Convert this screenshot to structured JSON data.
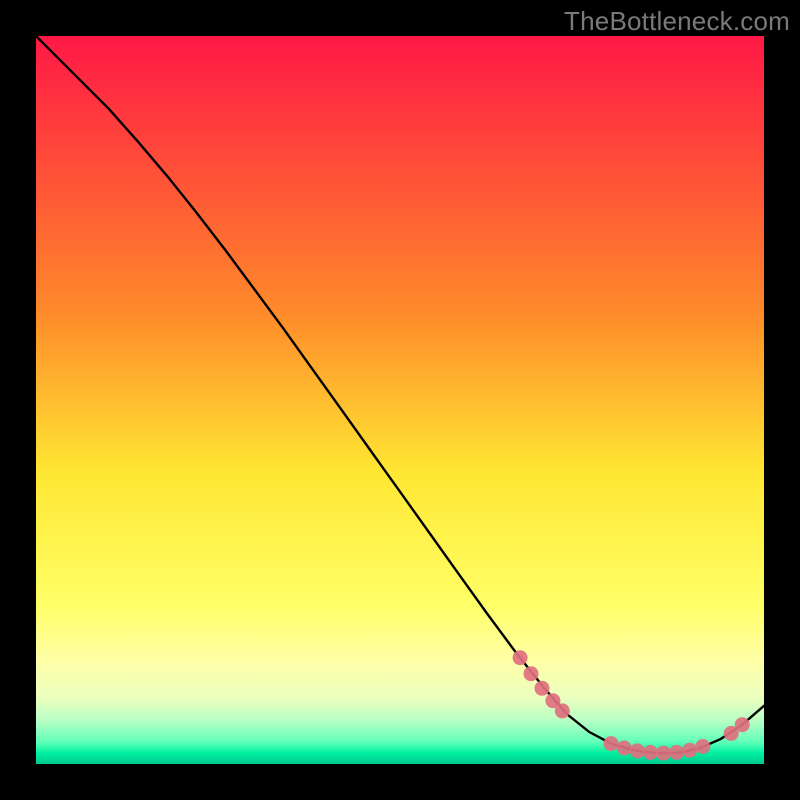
{
  "watermark": "TheBottleneck.com",
  "colors": {
    "dot": "#e0707f",
    "curve": "#000000",
    "border": "#000000"
  },
  "chart_data": {
    "type": "line",
    "title": "",
    "xlabel": "",
    "ylabel": "",
    "xlim": [
      0,
      100
    ],
    "ylim": [
      0,
      100
    ],
    "gradient_stops": [
      {
        "offset": 0.0,
        "color": "#ff1846"
      },
      {
        "offset": 0.38,
        "color": "#ff8a2a"
      },
      {
        "offset": 0.6,
        "color": "#ffe733"
      },
      {
        "offset": 0.78,
        "color": "#ffff66"
      },
      {
        "offset": 0.86,
        "color": "#ffffa8"
      },
      {
        "offset": 0.91,
        "color": "#eaffbf"
      },
      {
        "offset": 0.94,
        "color": "#b8ffc4"
      },
      {
        "offset": 0.97,
        "color": "#5fffb8"
      },
      {
        "offset": 0.985,
        "color": "#00f0a0"
      },
      {
        "offset": 1.0,
        "color": "#00c98f"
      }
    ],
    "series": [
      {
        "name": "bottleneck-curve",
        "x": [
          0,
          3,
          6,
          10,
          14,
          18,
          22,
          26,
          30,
          34,
          38,
          42,
          46,
          50,
          54,
          58,
          62,
          66,
          70,
          73,
          76,
          79,
          82,
          85,
          88,
          91,
          94,
          97,
          100
        ],
        "y": [
          100,
          97,
          94,
          90,
          85.5,
          80.8,
          75.8,
          70.6,
          65.2,
          59.8,
          54.2,
          48.6,
          43.0,
          37.4,
          31.8,
          26.2,
          20.6,
          15.2,
          10.2,
          6.8,
          4.4,
          2.8,
          1.9,
          1.5,
          1.5,
          2.1,
          3.4,
          5.4,
          8.0
        ]
      }
    ],
    "scatter": {
      "name": "highlighted-points",
      "points": [
        {
          "x": 66.5,
          "y": 14.6
        },
        {
          "x": 68.0,
          "y": 12.4
        },
        {
          "x": 69.5,
          "y": 10.4
        },
        {
          "x": 71.0,
          "y": 8.7
        },
        {
          "x": 72.3,
          "y": 7.3
        },
        {
          "x": 79.0,
          "y": 2.8
        },
        {
          "x": 80.8,
          "y": 2.2
        },
        {
          "x": 82.6,
          "y": 1.8
        },
        {
          "x": 84.4,
          "y": 1.6
        },
        {
          "x": 86.2,
          "y": 1.5
        },
        {
          "x": 88.0,
          "y": 1.6
        },
        {
          "x": 89.8,
          "y": 1.9
        },
        {
          "x": 91.6,
          "y": 2.4
        },
        {
          "x": 95.5,
          "y": 4.2
        },
        {
          "x": 97.0,
          "y": 5.4
        }
      ]
    }
  }
}
